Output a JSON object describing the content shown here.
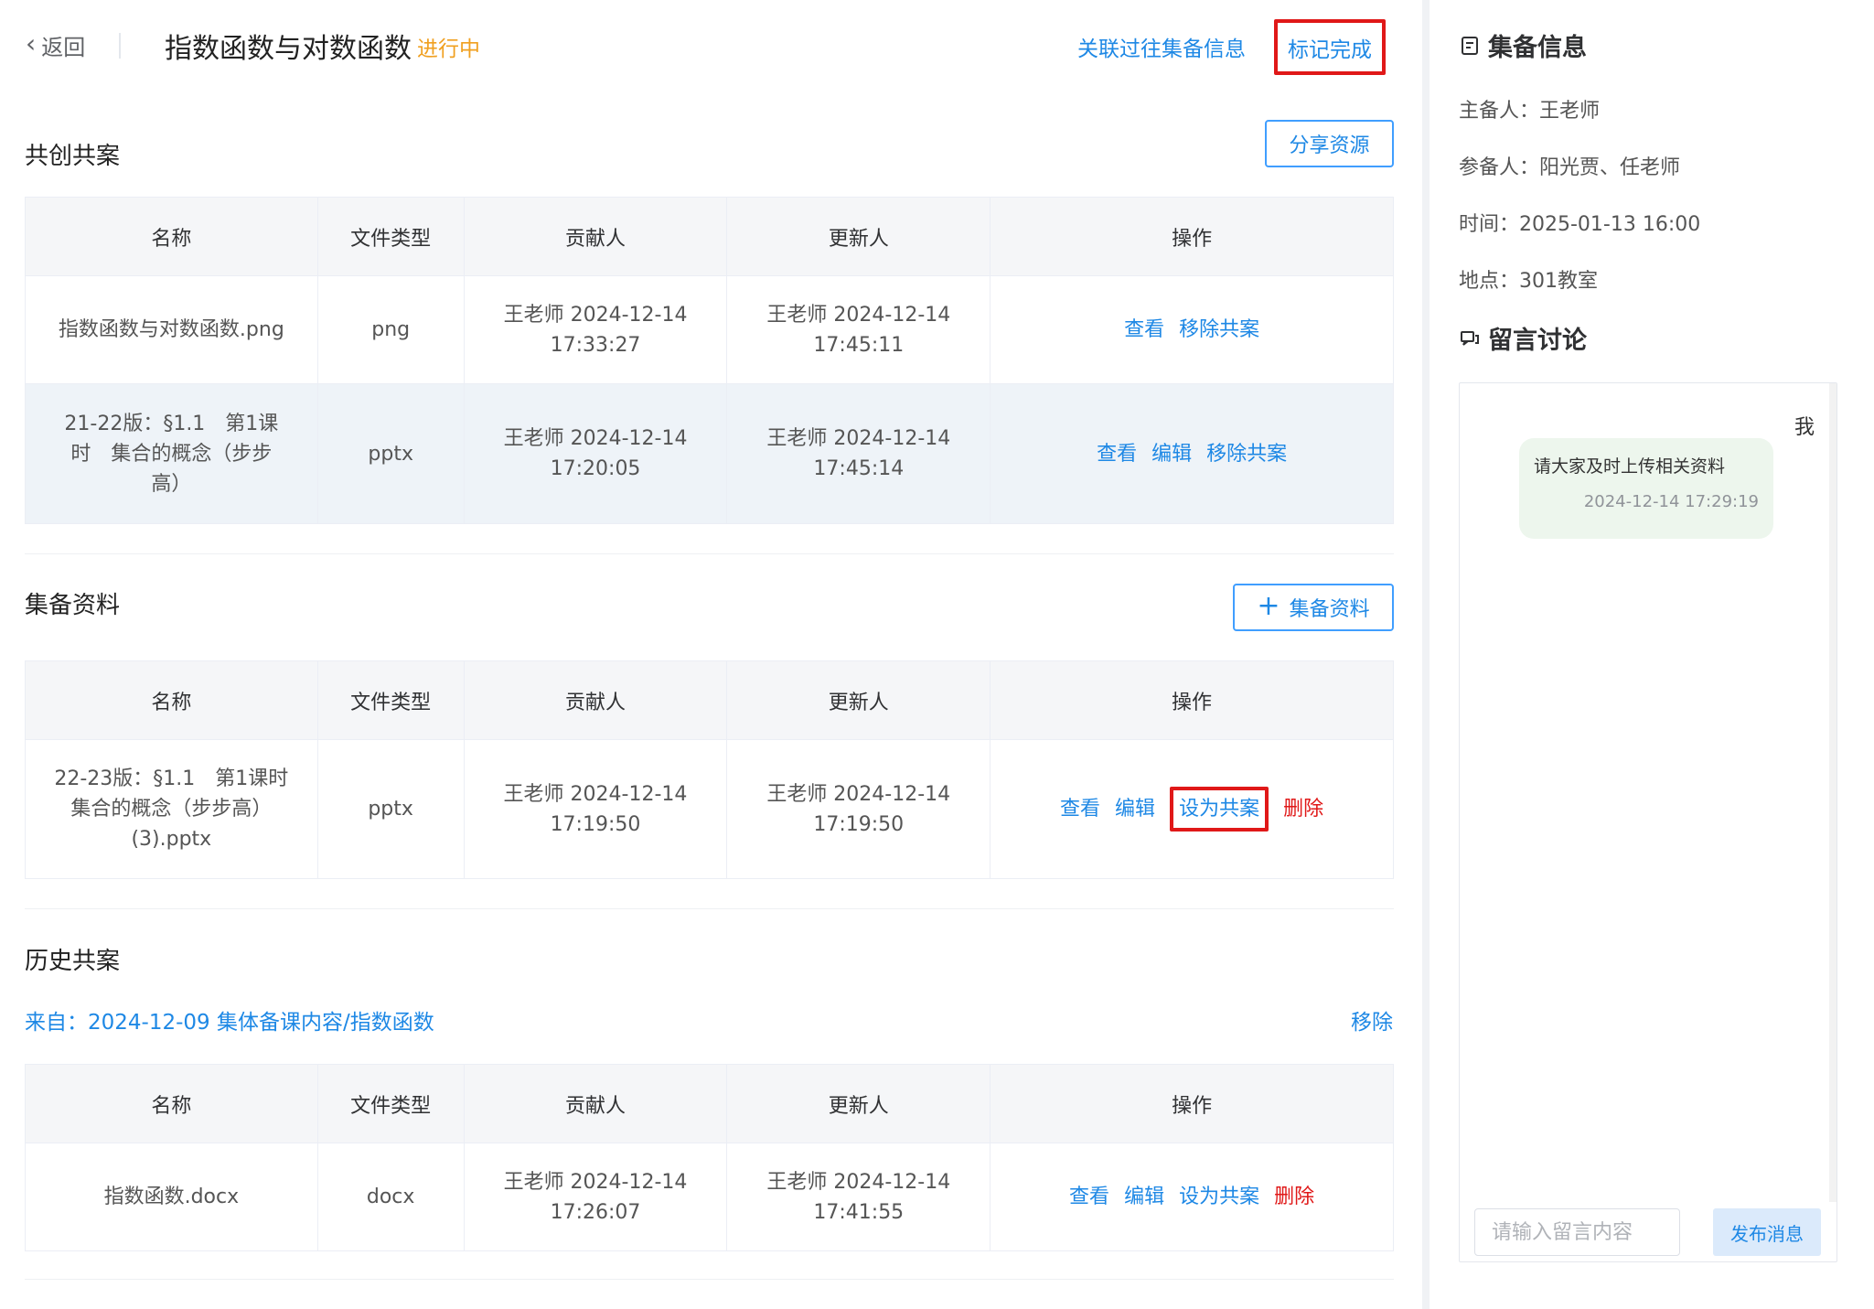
{
  "header": {
    "back_label": "返回",
    "title": "指数函数与对数函数",
    "status": "进行中",
    "related_link": "关联过往集备信息",
    "mark_done": "标记完成"
  },
  "colors": {
    "accent": "#1e88e5",
    "danger": "#e01818",
    "status": "#f0a020",
    "highlight_box": "#e01818"
  },
  "columns": [
    "名称",
    "文件类型",
    "贡献人",
    "更新人",
    "操作"
  ],
  "co_create": {
    "title": "共创共案",
    "button": "分享资源",
    "rows": [
      {
        "name": "指数函数与对数函数.png",
        "type": "png",
        "contrib_1": "王老师 2024-12-14",
        "contrib_2": "17:33:27",
        "update_1": "王老师 2024-12-14",
        "update_2": "17:45:11",
        "ops": [
          "查看",
          "移除共案"
        ]
      },
      {
        "name_1": "21-22版：§1.1　第1课",
        "name_2": "时　集合的概念（步步",
        "name_3": "高）",
        "type": "pptx",
        "contrib_1": "王老师 2024-12-14",
        "contrib_2": "17:20:05",
        "update_1": "王老师 2024-12-14",
        "update_2": "17:45:14",
        "ops": [
          "查看",
          "编辑",
          "移除共案"
        ]
      }
    ]
  },
  "prep_materials": {
    "title": "集备资料",
    "button": "集备资料",
    "rows": [
      {
        "name_1": "22-23版：§1.1　第1课时",
        "name_2": "集合的概念（步步高）",
        "name_3": "(3).pptx",
        "type": "pptx",
        "contrib_1": "王老师 2024-12-14",
        "contrib_2": "17:19:50",
        "update_1": "王老师 2024-12-14",
        "update_2": "17:19:50",
        "ops": [
          "查看",
          "编辑",
          "设为共案",
          "删除"
        ]
      }
    ]
  },
  "history": {
    "title": "历史共案",
    "from": "来自：2024-12-09 集体备课内容/指数函数",
    "remove": "移除",
    "rows": [
      {
        "name": "指数函数.docx",
        "type": "docx",
        "contrib_1": "王老师 2024-12-14",
        "contrib_2": "17:26:07",
        "update_1": "王老师 2024-12-14",
        "update_2": "17:41:55",
        "ops": [
          "查看",
          "编辑",
          "设为共案",
          "删除"
        ]
      }
    ]
  },
  "side": {
    "info_title": "集备信息",
    "host": "主备人：王老师",
    "participants": "参备人：阳光贾、任老师",
    "time": "时间：2025-01-13 16:00",
    "place": "地点：301教室",
    "discuss_title": "留言讨论",
    "me_label": "我",
    "message": "请大家及时上传相关资料",
    "message_time": "2024-12-14 17:29:19",
    "input_placeholder": "请输入留言内容",
    "send": "发布消息"
  }
}
